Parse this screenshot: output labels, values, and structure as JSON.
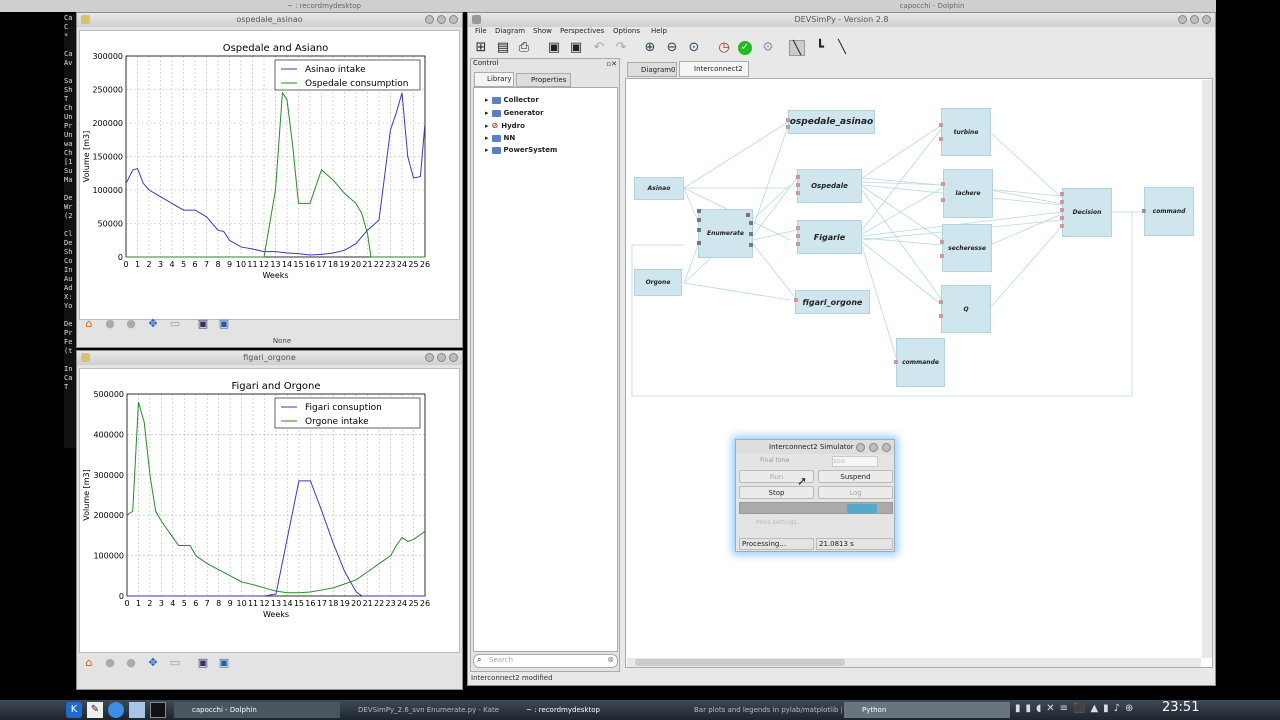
{
  "desktop": {
    "top_left_title": "~ : recordmydesktop",
    "top_right_title": "capocchi - Dolphin"
  },
  "terminal": {
    "lines": [
      "Ca",
      "C",
      "*",
      "",
      "Ca",
      "Av",
      "",
      "Sa",
      "Sh",
      "T",
      "Ch",
      "Un",
      "Pr",
      "Un",
      "wa",
      "Ch",
      "[1",
      "Su",
      "Ma",
      "",
      "De",
      "Wr",
      "(2",
      "",
      "Cl",
      "De",
      "Sh",
      "Co",
      "In",
      "Au",
      "Ad",
      "X:",
      "Yo",
      "",
      "De",
      "Pr",
      "Fe",
      "(t",
      "",
      "In",
      "Ca",
      "T"
    ]
  },
  "plot1": {
    "window_title": "ospedale_asinao",
    "status": "None",
    "chart_data": {
      "type": "line",
      "title": "Ospedale and Asiano",
      "xlabel": "Weeks",
      "ylabel": "Volume [m3]",
      "ylim": [
        0,
        300000
      ],
      "xlim": [
        0,
        26
      ],
      "yticks": [
        "0",
        "50000",
        "100000",
        "150000",
        "200000",
        "250000",
        "300000"
      ],
      "xticks": [
        "0",
        "1",
        "2",
        "3",
        "4",
        "5",
        "6",
        "7",
        "8",
        "9",
        "10",
        "11",
        "12",
        "13",
        "14",
        "15",
        "16",
        "17",
        "18",
        "19",
        "20",
        "21",
        "22",
        "23",
        "24",
        "25",
        "26"
      ],
      "grid": true,
      "legend": "top-right",
      "series": [
        {
          "name": "Asinao intake",
          "color": "#3a3ab8",
          "points": [
            [
              0,
              110000
            ],
            [
              0.6,
              130000
            ],
            [
              1,
              132000
            ],
            [
              1.5,
              110000
            ],
            [
              2,
              100000
            ],
            [
              3,
              90000
            ],
            [
              3.5,
              85000
            ],
            [
              4,
              80000
            ],
            [
              5,
              70000
            ],
            [
              6,
              70000
            ],
            [
              7,
              60000
            ],
            [
              8,
              40000
            ],
            [
              8.5,
              38000
            ],
            [
              9,
              25000
            ],
            [
              10,
              15000
            ],
            [
              11,
              12000
            ],
            [
              12,
              8000
            ],
            [
              13,
              8000
            ],
            [
              14,
              6000
            ],
            [
              15,
              5000
            ],
            [
              16,
              3000
            ],
            [
              17,
              4000
            ],
            [
              18,
              6000
            ],
            [
              19,
              10000
            ],
            [
              20,
              20000
            ],
            [
              21,
              40000
            ],
            [
              22,
              55000
            ],
            [
              23,
              190000
            ],
            [
              23.5,
              215000
            ],
            [
              24,
              245000
            ],
            [
              24.5,
              150000
            ],
            [
              25,
              118000
            ],
            [
              25.6,
              120000
            ],
            [
              26,
              200000
            ]
          ]
        },
        {
          "name": "Ospedale consumption",
          "color": "#2a8a2a",
          "points": [
            [
              0,
              0
            ],
            [
              12,
              0
            ],
            [
              13,
              100000
            ],
            [
              13.6,
              245000
            ],
            [
              14,
              235000
            ],
            [
              14.5,
              165000
            ],
            [
              15,
              80000
            ],
            [
              16,
              80000
            ],
            [
              17,
              130000
            ],
            [
              18,
              115000
            ],
            [
              19,
              95000
            ],
            [
              20,
              80000
            ],
            [
              20.5,
              65000
            ],
            [
              21,
              35000
            ],
            [
              21.3,
              0
            ],
            [
              26,
              0
            ]
          ]
        }
      ]
    }
  },
  "plot2": {
    "window_title": "figari_orgone",
    "chart_data": {
      "type": "line",
      "title": "Figari and Orgone",
      "xlabel": "Weeks",
      "ylabel": "Volume [m3]",
      "ylim": [
        0,
        500000
      ],
      "xlim": [
        0,
        26
      ],
      "yticks": [
        "0",
        "100000",
        "200000",
        "300000",
        "400000",
        "500000"
      ],
      "xticks": [
        "0",
        "1",
        "2",
        "3",
        "4",
        "5",
        "6",
        "7",
        "8",
        "9",
        "10",
        "11",
        "12",
        "13",
        "14",
        "15",
        "16",
        "17",
        "18",
        "19",
        "20",
        "21",
        "22",
        "23",
        "24",
        "25",
        "26"
      ],
      "grid": true,
      "legend": "top-right",
      "series": [
        {
          "name": "Figari consuption",
          "color": "#3a3ab8",
          "points": [
            [
              0,
              0
            ],
            [
              12,
              0
            ],
            [
              13,
              5000
            ],
            [
              15,
              285000
            ],
            [
              16,
              285000
            ],
            [
              17,
              210000
            ],
            [
              18,
              130000
            ],
            [
              19,
              60000
            ],
            [
              20,
              10000
            ],
            [
              20.5,
              0
            ],
            [
              26,
              0
            ]
          ]
        },
        {
          "name": "Orgone intake",
          "color": "#2a8a2a",
          "points": [
            [
              0,
              200000
            ],
            [
              0.5,
              210000
            ],
            [
              1,
              480000
            ],
            [
              1.5,
              430000
            ],
            [
              2,
              300000
            ],
            [
              2.5,
              210000
            ],
            [
              3,
              185000
            ],
            [
              4,
              145000
            ],
            [
              4.5,
              125000
            ],
            [
              5.5,
              125000
            ],
            [
              6,
              100000
            ],
            [
              7,
              80000
            ],
            [
              8,
              65000
            ],
            [
              9,
              50000
            ],
            [
              10,
              35000
            ],
            [
              11,
              28000
            ],
            [
              12,
              20000
            ],
            [
              13,
              12000
            ],
            [
              14,
              8000
            ],
            [
              15,
              8000
            ],
            [
              16,
              10000
            ],
            [
              17,
              15000
            ],
            [
              18,
              20000
            ],
            [
              19,
              30000
            ],
            [
              20,
              40000
            ],
            [
              21,
              60000
            ],
            [
              22,
              80000
            ],
            [
              23,
              100000
            ],
            [
              23.5,
              125000
            ],
            [
              24,
              145000
            ],
            [
              24.5,
              135000
            ],
            [
              25,
              140000
            ],
            [
              26,
              160000
            ]
          ]
        }
      ]
    }
  },
  "devsimpy": {
    "window_title": "DEVSimPy - Version 2.8",
    "menu": [
      "File",
      "Diagram",
      "Show",
      "Perspectives",
      "Options",
      "Help"
    ],
    "control_label": "Control",
    "tabs": [
      "Library",
      "Properties"
    ],
    "tree": [
      "Collector",
      "Generator",
      "Hydro",
      "NN",
      "PowerSystem"
    ],
    "search_placeholder": "Search",
    "diagram_tabs": [
      "Diagram0",
      "Interconnect2"
    ],
    "status": "Interconnect2 modified",
    "blocks": [
      "ospedale_asinao",
      "Asinao",
      "Enumerate",
      "Orgone",
      "Ospedale",
      "Figarie",
      "figari_orgone",
      "turbine",
      "lachere",
      "secheresse",
      "Q",
      "commande",
      "Decision",
      "command"
    ]
  },
  "simulator": {
    "title": "Interconnect2 Simulator",
    "final_time_label": "Final time",
    "final_time_value": "10.0",
    "run": "Run",
    "suspend": "Suspend",
    "stop": "Stop",
    "log": "Log",
    "more_settings": "More settings...",
    "status": "Processing...",
    "elapsed": "21.0813 s"
  },
  "taskbar": {
    "items": [
      "capocchi - Dolphin",
      "DEVSimPy_2.6_svn Enumerate.py - Kate",
      "~ : recordmydesktop",
      "Bar plots and legends in pylab/matplotlib | ...",
      "Python"
    ],
    "clock": "23:51"
  }
}
